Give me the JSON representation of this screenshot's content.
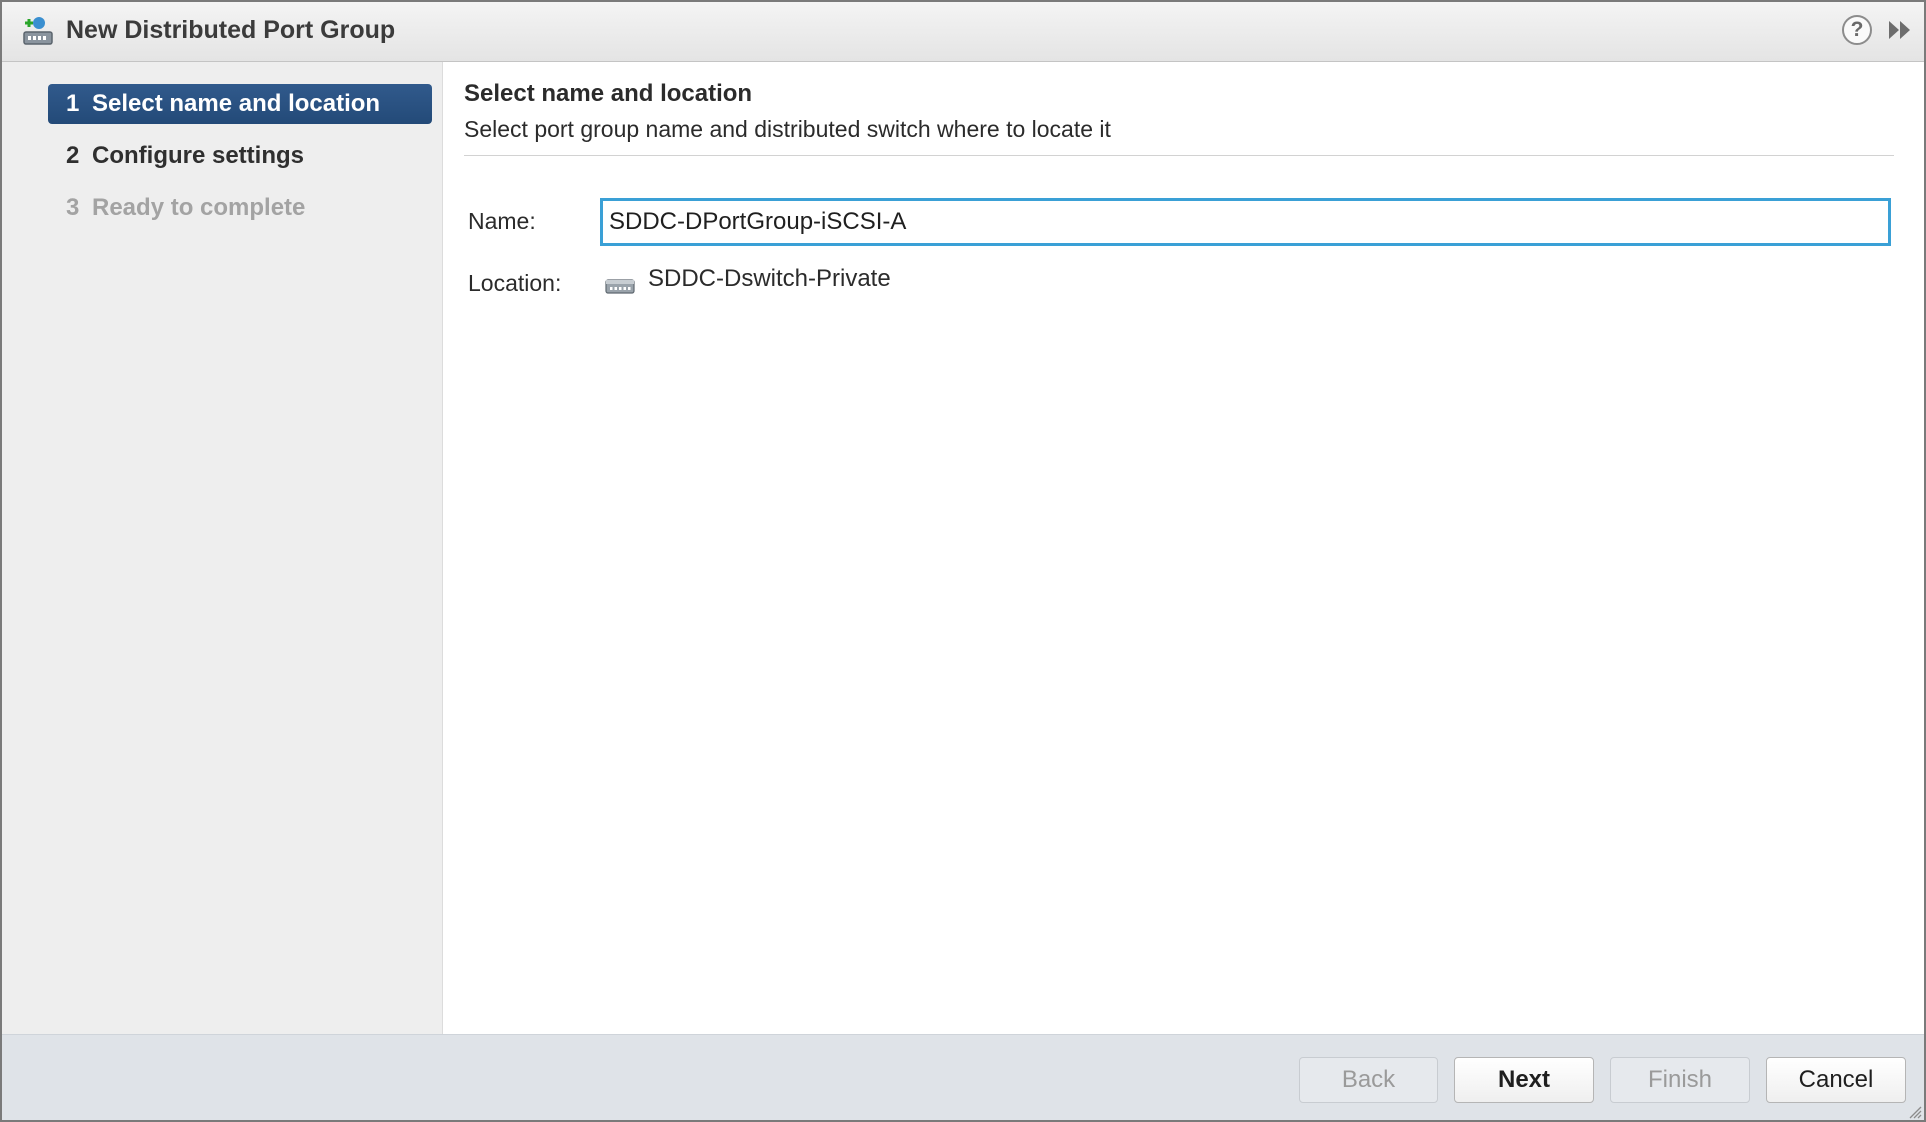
{
  "window": {
    "title": "New Distributed Port Group",
    "icons": [
      "add-portgroup-icon",
      "help-icon",
      "expand-panel-icon"
    ],
    "help_glyph": "?"
  },
  "nav": {
    "items": [
      {
        "number": "1",
        "label": "Select name and location",
        "state": "active"
      },
      {
        "number": "2",
        "label": "Configure settings",
        "state": "enabled"
      },
      {
        "number": "3",
        "label": "Ready to complete",
        "state": "disabled"
      }
    ]
  },
  "content": {
    "title": "Select name and location",
    "subtitle": "Select port group name and distributed switch where to locate it",
    "name_label": "Name:",
    "name_value": "SDDC-DPortGroup-iSCSI-A",
    "location_label": "Location:",
    "location_value": "SDDC-Dswitch-Private",
    "location_icon": "distributed-switch-icon"
  },
  "footer": {
    "back_label": "Back",
    "next_label": "Next",
    "finish_label": "Finish",
    "cancel_label": "Cancel"
  },
  "colors": {
    "active_nav": "#2c5282",
    "focus_border": "#3aa0d6",
    "nav_bg": "#eeeeee",
    "footer_bg": "#dfe3e8"
  }
}
